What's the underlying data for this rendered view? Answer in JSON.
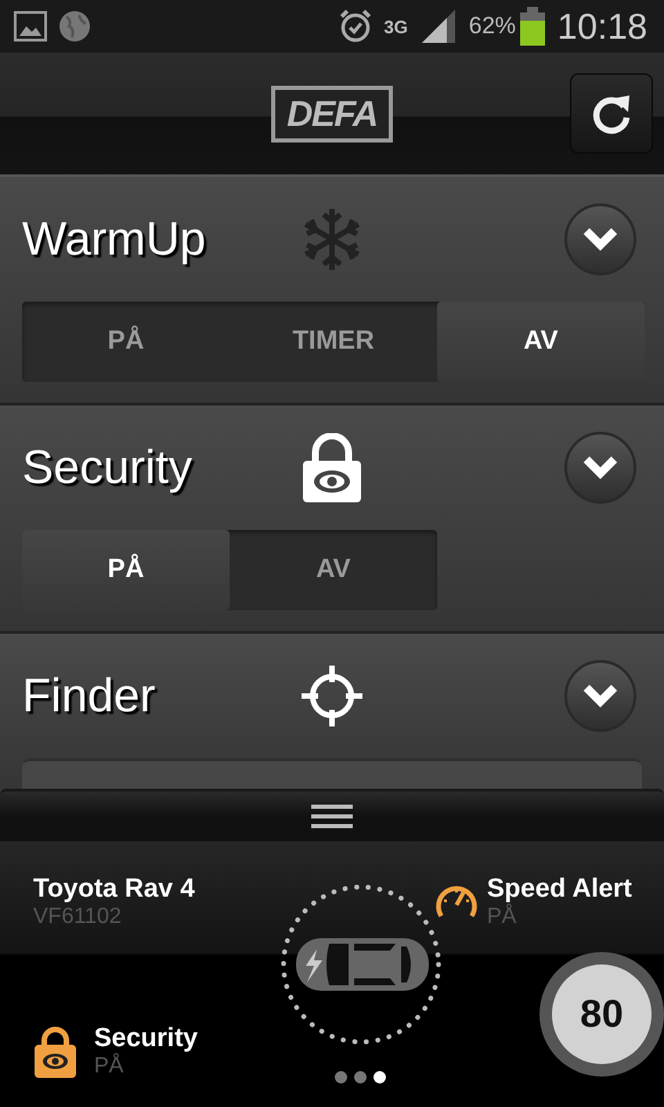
{
  "status_bar": {
    "network": "3G",
    "battery": "62%",
    "time": "10:18"
  },
  "header": {
    "logo": "DEFA"
  },
  "sections": [
    {
      "kind": "warmup",
      "title": "WarmUp",
      "expanded": false,
      "options": [
        {
          "label": "PÅ",
          "selected": false
        },
        {
          "label": "TIMER",
          "selected": false
        },
        {
          "label": "AV",
          "selected": true
        }
      ]
    },
    {
      "kind": "security",
      "title": "Security",
      "expanded": false,
      "options": [
        {
          "label": "PÅ",
          "selected": true
        },
        {
          "label": "AV",
          "selected": false
        }
      ]
    },
    {
      "kind": "finder",
      "title": "Finder",
      "expanded": false
    }
  ],
  "vehicle": {
    "name": "Toyota Rav 4",
    "id": "VF61102"
  },
  "speed_alert": {
    "label": "Speed Alert",
    "status": "PÅ",
    "speed": "80"
  },
  "security_status": {
    "label": "Security",
    "status": "PÅ"
  },
  "pages": [
    {
      "selected": false
    },
    {
      "selected": false
    },
    {
      "selected": true
    }
  ]
}
